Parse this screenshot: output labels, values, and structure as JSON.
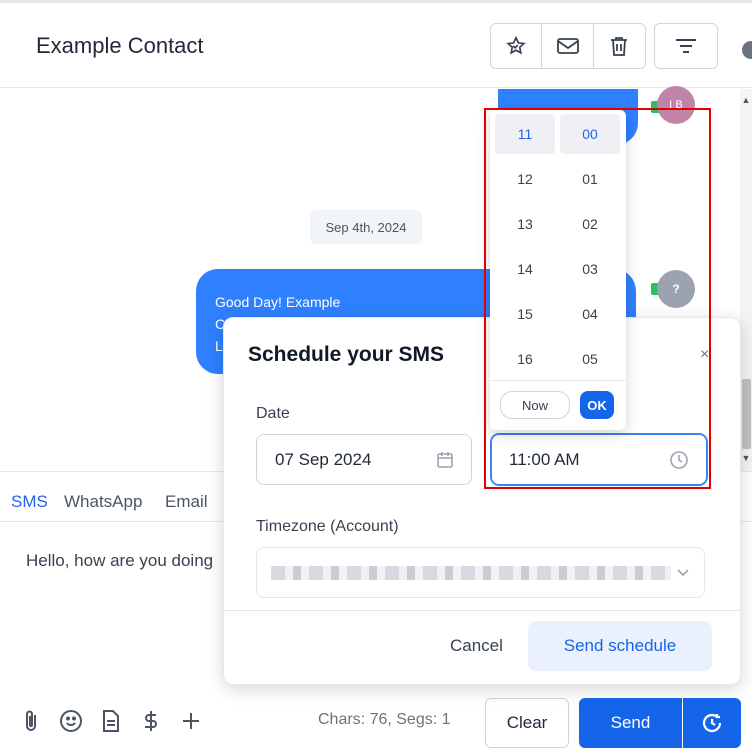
{
  "header": {
    "contact_name": "Example Contact",
    "actions": [
      "star-check-icon",
      "mail-icon",
      "trash-icon"
    ],
    "filter_icon": "filter-lines-icon"
  },
  "conversation": {
    "avatar_top": "I B",
    "date_divider": "Sep 4th, 2024",
    "message": {
      "line1": "Good Day! Example",
      "line2": "C",
      "line3": "L"
    },
    "avatar_main": "?"
  },
  "composer": {
    "tabs": [
      {
        "label": "SMS",
        "active": true
      },
      {
        "label": "WhatsApp",
        "active": false
      },
      {
        "label": "Email",
        "active": false
      }
    ],
    "message_text": "Hello, how are you doing",
    "tool_icons": [
      "paperclip-icon",
      "emoji-icon",
      "document-icon",
      "dollar-icon",
      "plus-icon"
    ],
    "chars_label": "Chars: 76, Segs: 1",
    "clear_label": "Clear",
    "send_label": "Send",
    "schedule_icon": "clock-arrow-icon"
  },
  "modal": {
    "title": "Schedule your SMS",
    "close_glyph": "×",
    "date_label": "Date",
    "date_value": "07 Sep 2024",
    "time_value": "11:00 AM",
    "timezone_label": "Timezone (Account)",
    "cancel_label": "Cancel",
    "submit_label": "Send schedule"
  },
  "time_picker": {
    "hours": [
      "11",
      "12",
      "13",
      "14",
      "15",
      "16"
    ],
    "minutes": [
      "00",
      "01",
      "02",
      "03",
      "04",
      "05"
    ],
    "selected_hour": "11",
    "selected_minute": "00",
    "now_label": "Now",
    "ok_label": "OK"
  },
  "colors": {
    "accent": "#1565e9",
    "bubble": "#2f80ff",
    "highlight": "#e00000"
  }
}
